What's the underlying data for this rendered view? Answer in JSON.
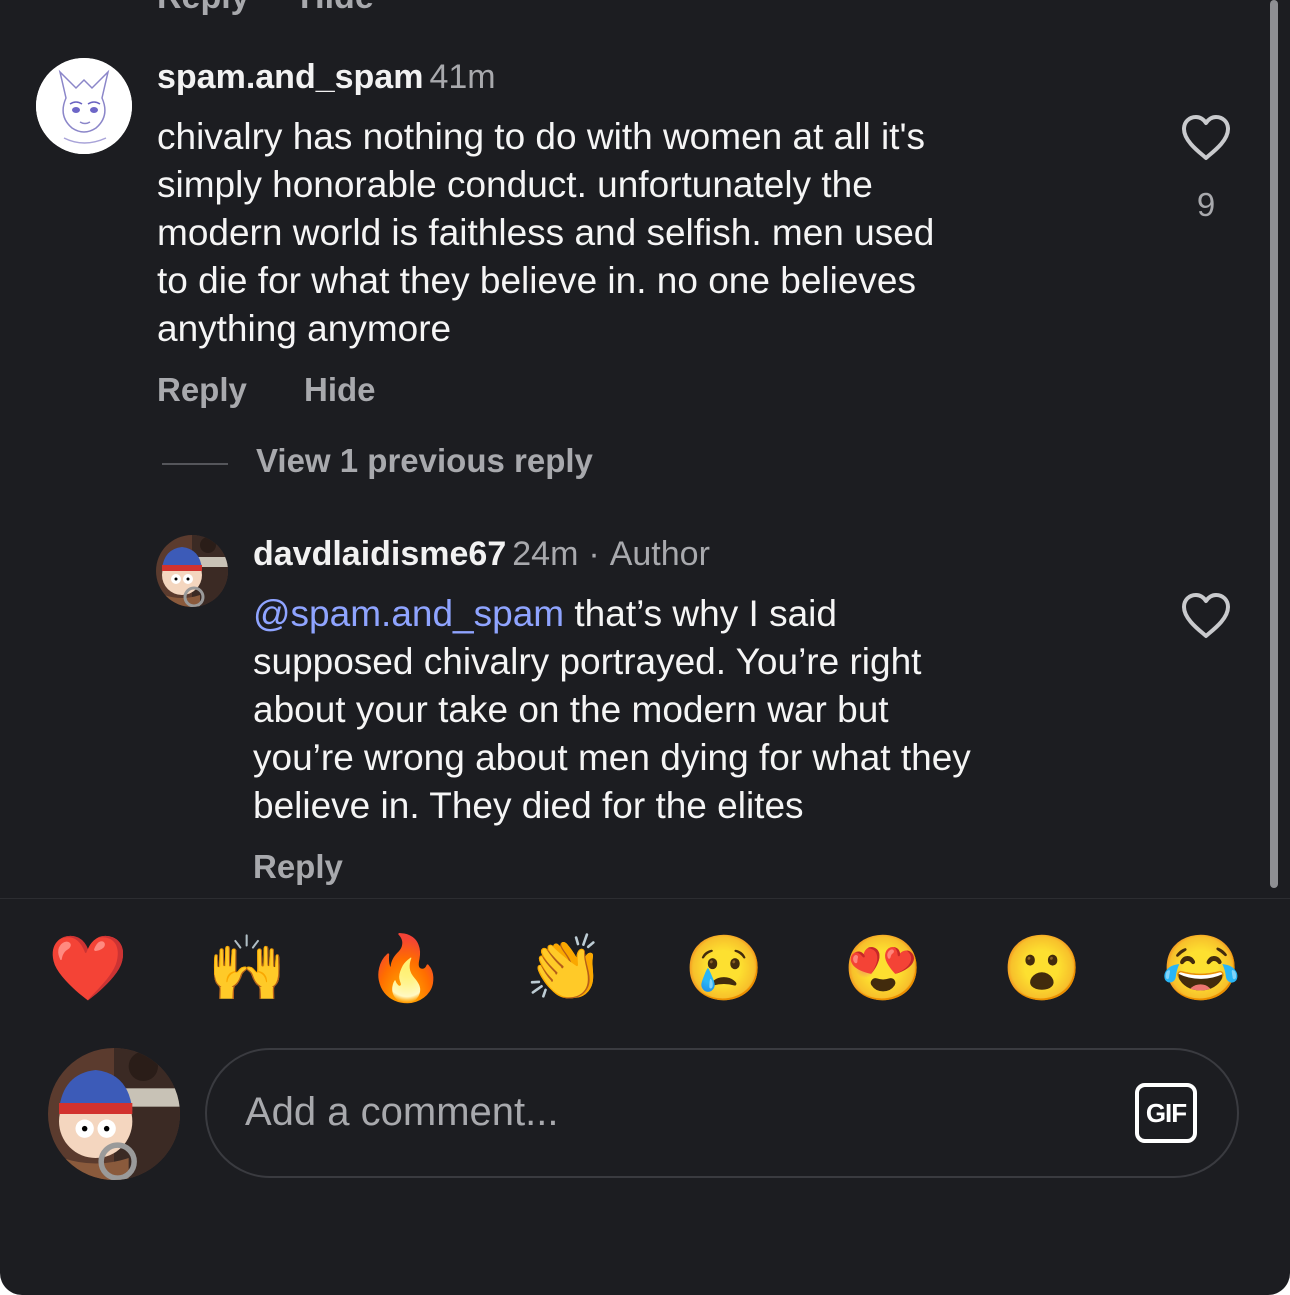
{
  "previous_comment": {
    "reply_label": "Reply",
    "hide_label": "Hide"
  },
  "comments": [
    {
      "username": "spam.and_spam",
      "time": "41m",
      "text": "chivalry has nothing to do with women at all it's simply honorable conduct. unfortunately the modern world is faithless and selfish. men used to die for what they believe in. no one believes anything anymore",
      "lines": [
        "chivalry has nothing to do with women at all it's",
        "simply honorable conduct. unfortunately the",
        "modern world is faithless and selfish. men used",
        "to die for what they believe in. no one believes",
        "anything anymore"
      ],
      "like_count": "9",
      "reply_label": "Reply",
      "hide_label": "Hide"
    }
  ],
  "view_previous_label": "View 1 previous reply",
  "reply": {
    "username": "davdlaidisme67",
    "time": "24m",
    "separator": "·",
    "author_label": "Author",
    "mention": "@spam.and_spam",
    "line1_rest": " that’s why I said",
    "lines": [
      "supposed chivalry portrayed. You’re right",
      "about your take on the modern war but",
      "you’re wrong about men dying for what they",
      "believe in. They died for the elites"
    ],
    "reply_label": "Reply"
  },
  "emoji_bar": [
    {
      "name": "red-heart",
      "glyph": "❤️"
    },
    {
      "name": "raising-hands",
      "glyph": "🙌"
    },
    {
      "name": "fire",
      "glyph": "🔥"
    },
    {
      "name": "clapping-hands",
      "glyph": "👏"
    },
    {
      "name": "crying-face",
      "glyph": "😢"
    },
    {
      "name": "heart-eyes",
      "glyph": "😍"
    },
    {
      "name": "surprised-face",
      "glyph": "😮"
    },
    {
      "name": "tears-of-joy",
      "glyph": "😂"
    }
  ],
  "composer": {
    "placeholder": "Add a comment...",
    "gif_label": "GIF"
  },
  "colors": {
    "background": "#1c1d21",
    "text": "#f5f5f5",
    "muted": "#a8a9ad",
    "mention": "#8fa4ff"
  }
}
